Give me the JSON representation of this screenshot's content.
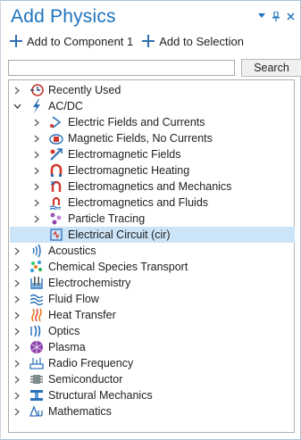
{
  "title": "Add Physics",
  "toolbar": {
    "add_component": "Add to Component 1",
    "add_selection": "Add to Selection"
  },
  "search": {
    "value": "",
    "button": "Search"
  },
  "tree": {
    "recently_used": "Recently Used",
    "acdc": "AC/DC",
    "acdc_children": [
      "Electric Fields and Currents",
      "Magnetic Fields, No Currents",
      "Electromagnetic Fields",
      "Electromagnetic Heating",
      "Electromagnetics and Mechanics",
      "Electromagnetics and Fluids",
      "Particle Tracing",
      "Electrical Circuit (cir)"
    ],
    "top": [
      "Acoustics",
      "Chemical Species Transport",
      "Electrochemistry",
      "Fluid Flow",
      "Heat Transfer",
      "Optics",
      "Plasma",
      "Radio Frequency",
      "Semiconductor",
      "Structural Mechanics",
      "Mathematics"
    ]
  },
  "colors": {
    "title": "#1e73be",
    "selected": "#cce4f7",
    "accent": "#2f6fad"
  }
}
